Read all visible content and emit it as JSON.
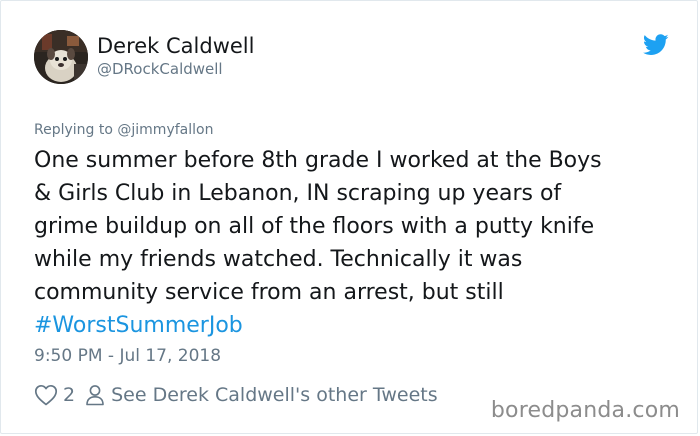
{
  "author": {
    "display_name": "Derek Caldwell",
    "handle": "@DRockCaldwell",
    "avatar_icon": "profile-photo"
  },
  "logo": {
    "icon": "twitter-bird-icon",
    "color": "#1da1f2"
  },
  "reply": {
    "prefix": "Replying to ",
    "mention": "@jimmyfallon"
  },
  "tweet": {
    "lines": [
      "One summer before 8th grade I worked at the Boys",
      "& Girls Club in Lebanon, IN scraping up years of",
      "grime buildup on all of the floors with a putty knife",
      "while my friends watched. Technically it was",
      "community service from an arrest, but still"
    ],
    "hashtag": "#WorstSummerJob",
    "hashtag_color": "#1b95e0",
    "timestamp": "9:50 PM - Jul 17, 2018"
  },
  "actions": {
    "like_icon": "heart-icon",
    "like_count": "2",
    "profile_icon": "person-icon",
    "profile_link": "See Derek Caldwell's other Tweets"
  },
  "watermark": "boredpanda.com"
}
